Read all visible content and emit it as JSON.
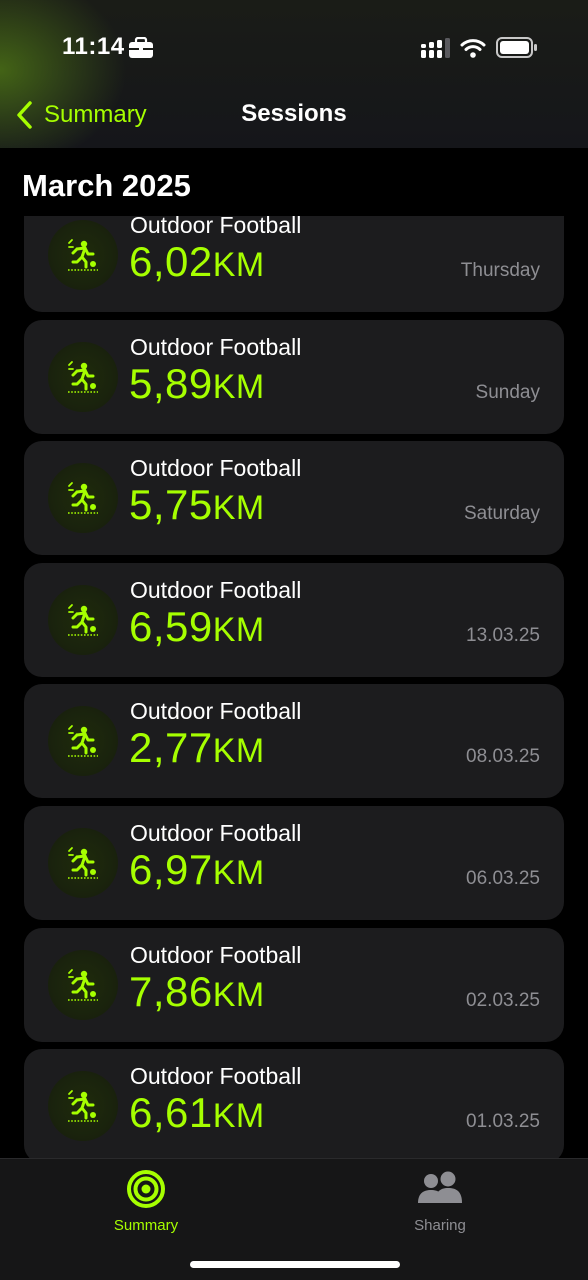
{
  "status_bar": {
    "time": "11:14",
    "icons": [
      "briefcase-icon",
      "signal-icon",
      "wifi-icon",
      "battery-icon"
    ]
  },
  "nav": {
    "back_label": "Summary",
    "title": "Sessions"
  },
  "section": {
    "title": "March 2025"
  },
  "sessions": [
    {
      "activity": "Outdoor Football",
      "value": "6,02",
      "unit": "KM",
      "date": "Thursday"
    },
    {
      "activity": "Outdoor Football",
      "value": "5,89",
      "unit": "KM",
      "date": "Sunday"
    },
    {
      "activity": "Outdoor Football",
      "value": "5,75",
      "unit": "KM",
      "date": "Saturday"
    },
    {
      "activity": "Outdoor Football",
      "value": "6,59",
      "unit": "KM",
      "date": "13.03.25"
    },
    {
      "activity": "Outdoor Football",
      "value": "2,77",
      "unit": "KM",
      "date": "08.03.25"
    },
    {
      "activity": "Outdoor Football",
      "value": "6,97",
      "unit": "KM",
      "date": "06.03.25"
    },
    {
      "activity": "Outdoor Football",
      "value": "7,86",
      "unit": "KM",
      "date": "02.03.25"
    },
    {
      "activity": "Outdoor Football",
      "value": "6,61",
      "unit": "KM",
      "date": "01.03.25"
    }
  ],
  "tab_bar": {
    "tabs": [
      {
        "label": "Summary",
        "icon": "activity-rings-icon",
        "selected": true
      },
      {
        "label": "Sharing",
        "icon": "people-icon",
        "selected": false
      }
    ]
  },
  "colors": {
    "accent": "#a6ff00",
    "background": "#000000",
    "card": "#1c1c1e",
    "secondary_text": "#8e8e93"
  }
}
